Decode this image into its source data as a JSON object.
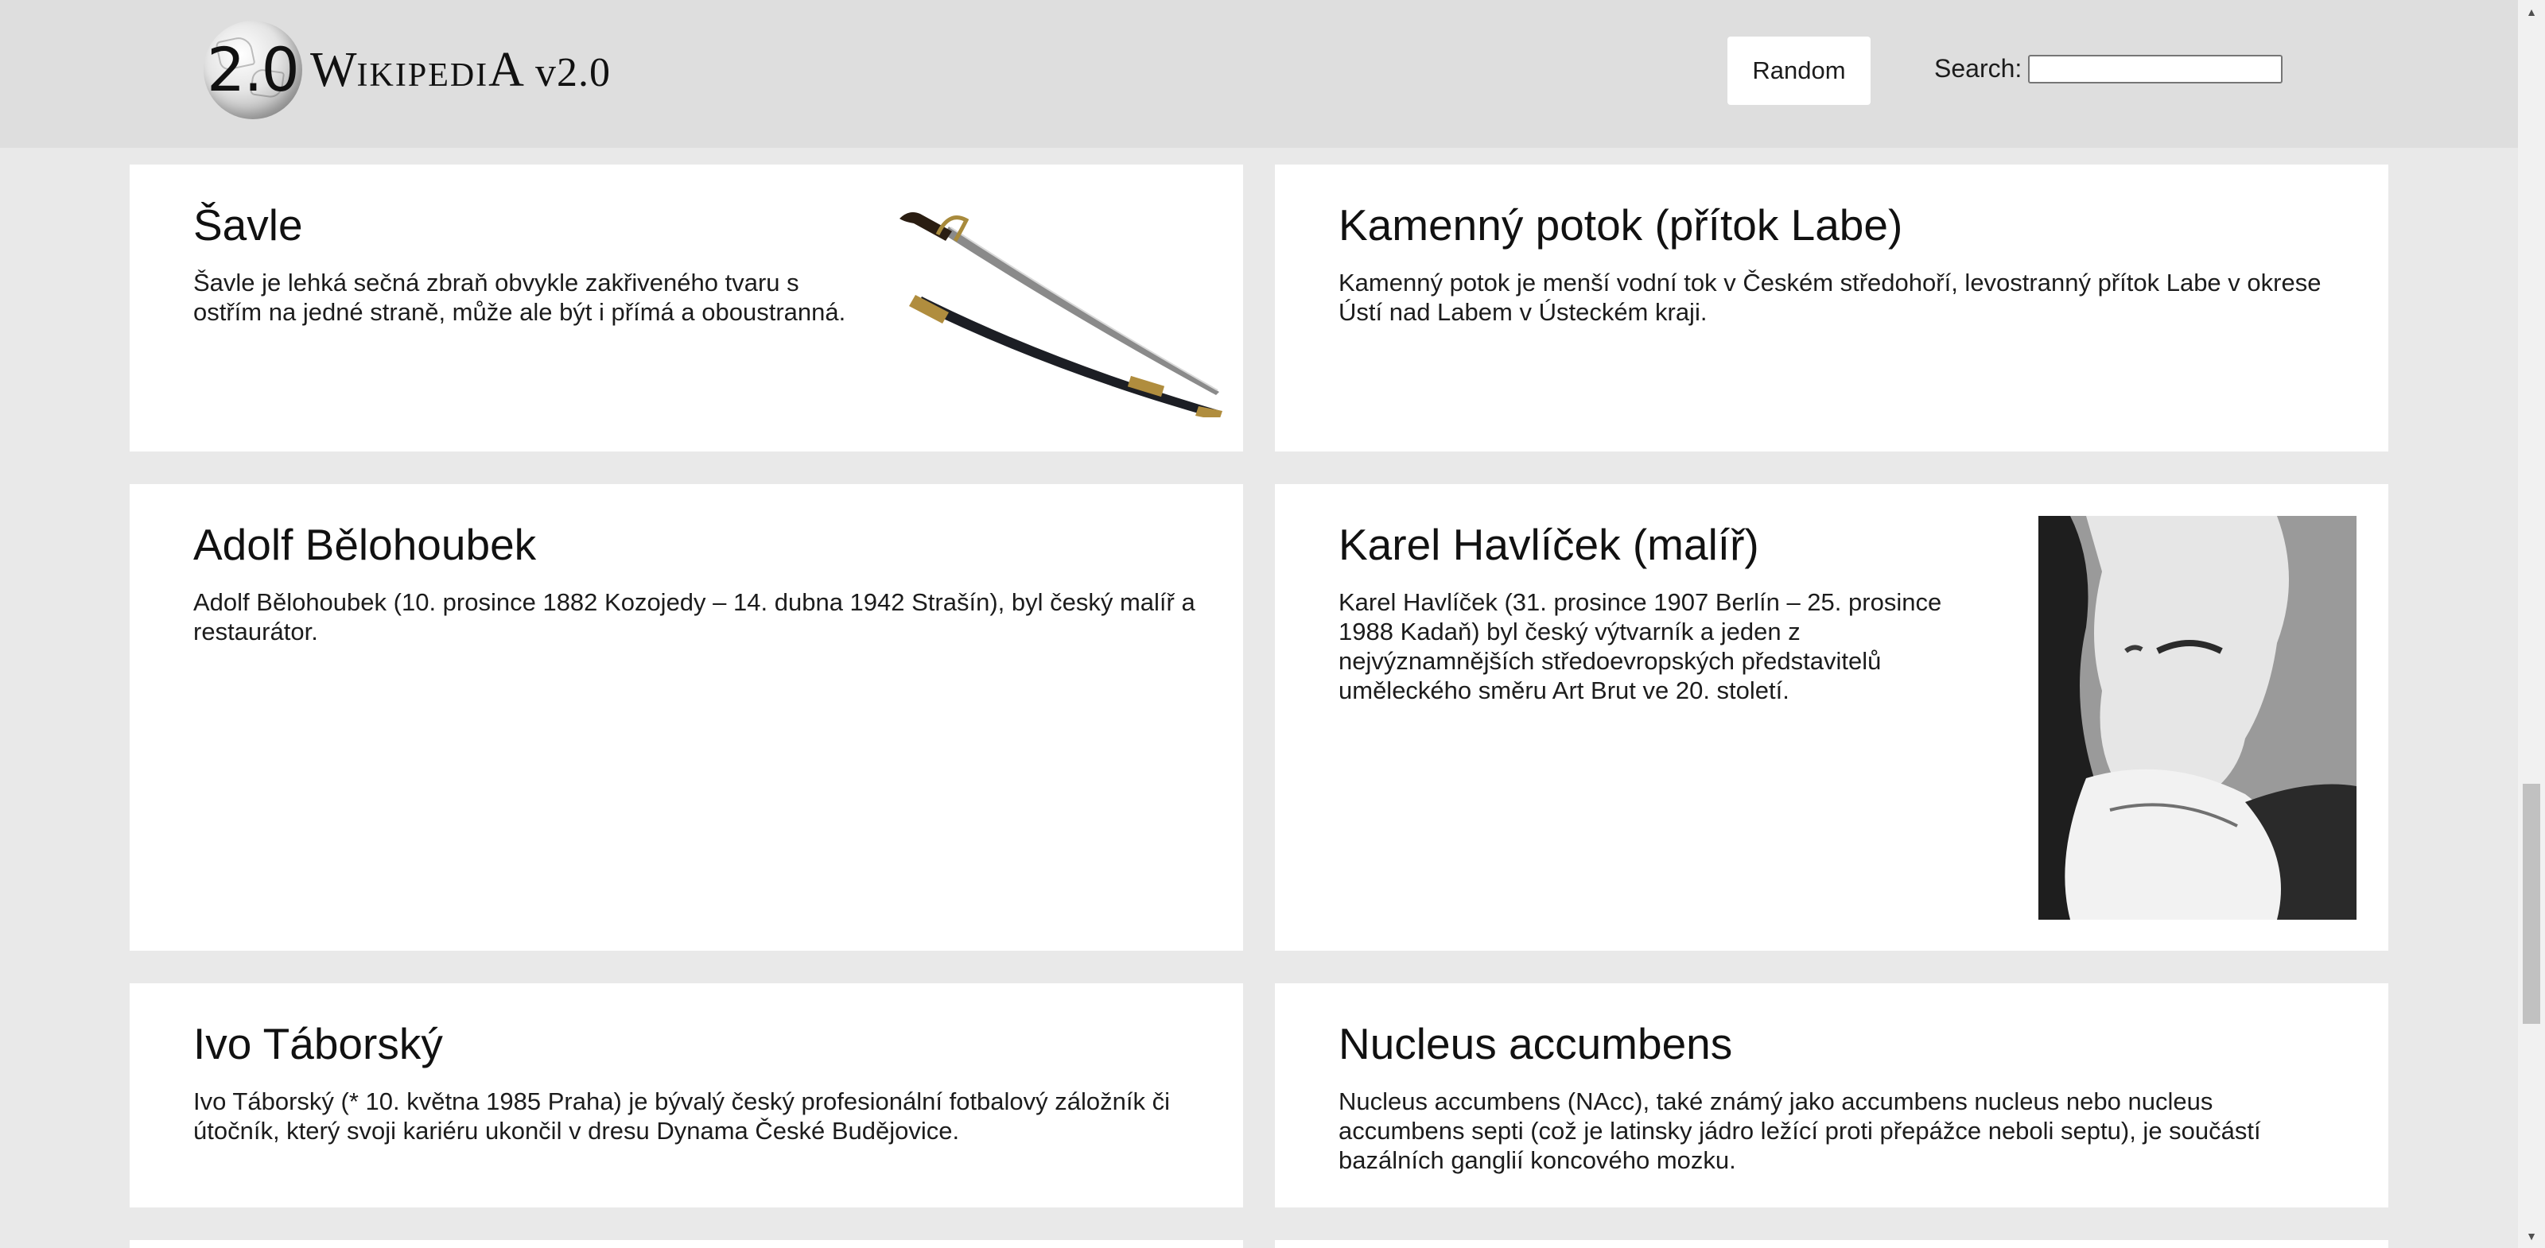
{
  "header": {
    "logo_number": "2.0",
    "wordmark": {
      "w": "W",
      "ikipedi": "ikipedi",
      "a": "A",
      "version": "v2.0"
    },
    "random_label": "Random",
    "search_label": "Search:",
    "search_value": "",
    "search_placeholder": ""
  },
  "cards": [
    {
      "title": "Šavle",
      "text": "Šavle je lehká sečná zbraň obvykle zakřiveného tvaru s ostřím na jedné straně, může ale být i přímá a oboustranná.",
      "image": "sabre-image"
    },
    {
      "title": "Kamenný potok (přítok Labe)",
      "text": "Kamenný potok je menší vodní tok v Českém středohoří, levostranný přítok Labe v okrese Ústí nad Labem v Ústeckém kraji."
    },
    {
      "title": "Adolf Bělohoubek",
      "text": "Adolf Bělohoubek (10. prosince 1882 Kozojedy – 14. dubna 1942 Strašín), byl český malíř a restaurátor."
    },
    {
      "title": "Karel Havlíček (malíř)",
      "text": "Karel Havlíček (31. prosince 1907 Berlín – 25. prosince 1988 Kadaň) byl český výtvarník a jeden z nejvýznamnějších středoevropských představitelů uměleckého směru Art Brut ve 20. století.",
      "image": "portrait-photo"
    },
    {
      "title": "Ivo Táborský",
      "text": "Ivo Táborský (* 10. května 1985 Praha) je bývalý český profesionální fotbalový záložník či útočník, který svoji kariéru ukončil v dresu Dynama České Budějovice."
    },
    {
      "title": "Nucleus accumbens",
      "text": "Nucleus accumbens (NAcc), také známý jako accumbens nucleus nebo nucleus accumbens septi (což je latinsky jádro ležící proti přepážce neboli septu), je součástí bazálních ganglií koncového mozku."
    }
  ],
  "scrollbar": {
    "position_fraction": 0.64
  },
  "icons": {
    "logo": "wikipedia-globe-icon",
    "scroll_up": "triangle-up-icon",
    "scroll_down": "triangle-down-icon"
  }
}
